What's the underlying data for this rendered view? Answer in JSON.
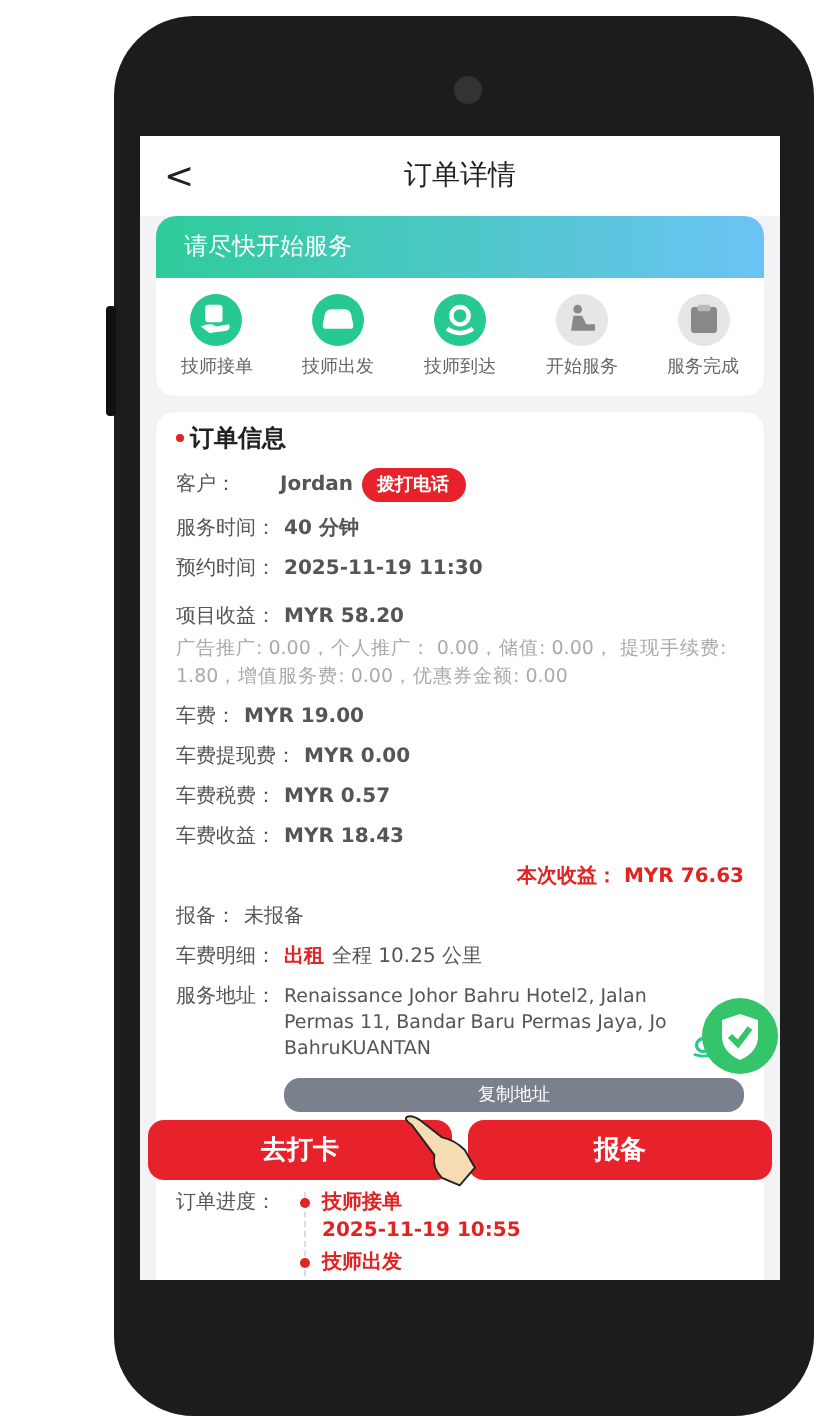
{
  "header": {
    "back": "<",
    "title": "订单详情"
  },
  "status": {
    "banner": "请尽快开始服务",
    "steps": [
      {
        "label": "技师接单",
        "done": true
      },
      {
        "label": "技师出发",
        "done": true
      },
      {
        "label": "技师到达",
        "done": true
      },
      {
        "label": "开始服务",
        "done": false
      },
      {
        "label": "服务完成",
        "done": false
      }
    ]
  },
  "order": {
    "title": "订单信息",
    "customer_label": "客户：",
    "customer": "Jordan",
    "call_button": "拨打电话",
    "rows_a": [
      {
        "label": "服务时间：",
        "value": "40 分钟"
      },
      {
        "label": "预约时间：",
        "value": "2025-11-19 11:30"
      }
    ],
    "income": {
      "label": "项目收益：",
      "value": "MYR 58.20"
    },
    "note": "广告推广: 0.00，个人推广： 0.00，储值: 0.00， 提现手续费: 1.80，增值服务费: 0.00，优惠券金额: 0.00",
    "rows_b": [
      {
        "label": "车费：",
        "value": "MYR 19.00"
      },
      {
        "label": "车费提现费：",
        "value": "MYR 0.00"
      },
      {
        "label": "车费税费：",
        "value": "MYR 0.57"
      },
      {
        "label": "车费收益：",
        "value": "MYR 18.43"
      }
    ],
    "total": "本次收益：  MYR 76.63",
    "report": {
      "label": "报备：",
      "value": "未报备"
    },
    "fare": {
      "label": "车费明细：",
      "tag": "出租",
      "value": "全程 10.25 公里"
    },
    "address": {
      "label": "服务地址：",
      "value": "Renaissance Johor Bahru Hotel2, Jalan Permas 11, Bandar Baru Permas Jaya, Jo BahruKUANTAN"
    },
    "copy_button": "复制地址",
    "progress_label": "订单进度：",
    "timeline": [
      {
        "label": "技师接单",
        "time": "2025-11-19 10:55"
      },
      {
        "label": "技师出发"
      }
    ]
  },
  "actions": [
    "去打卡",
    "报备"
  ]
}
